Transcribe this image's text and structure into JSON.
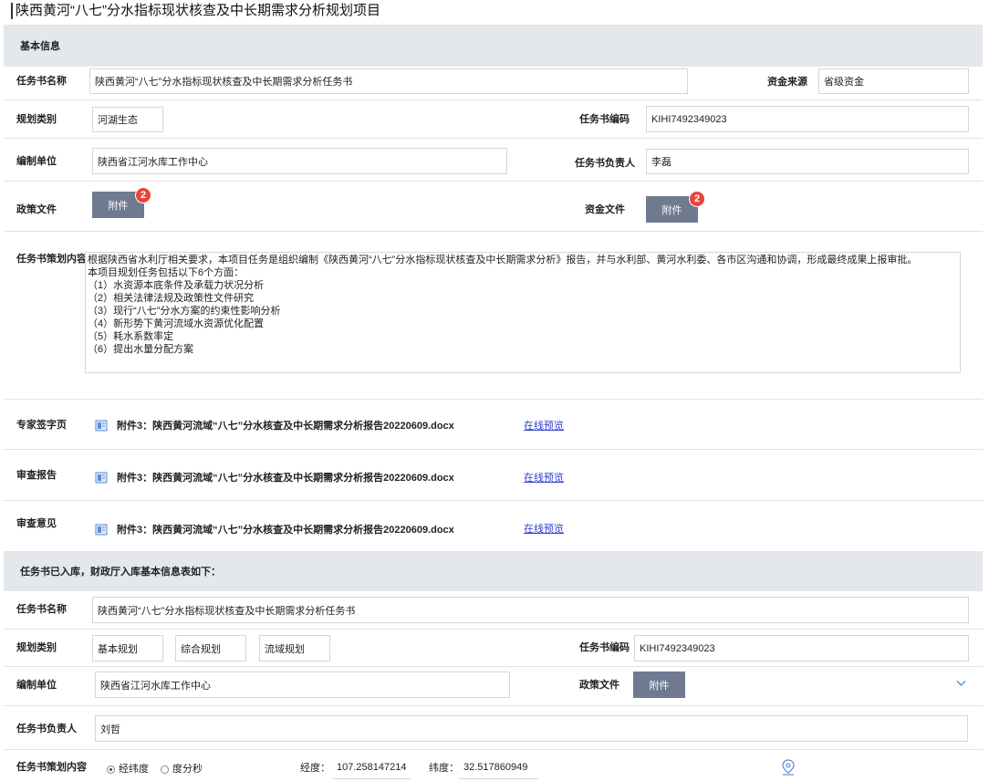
{
  "page_title": "陕西黄河“八七”分水指标现状核查及中长期需求分析规划项目",
  "basic": {
    "section_title": "基本信息",
    "task_name_label": "任务书名称",
    "task_name_value": "陕西黄河“八七”分水指标现状核查及中长期需求分析任务书",
    "fund_source_label": "资金来源",
    "fund_source_value": "省级资金",
    "plan_type_label": "规划类别",
    "plan_type_value": "河湖生态",
    "task_code_label": "任务书编码",
    "task_code_value": "KIHI7492349023",
    "org_label": "编制单位",
    "org_value": "陕西省江河水库工作中心",
    "owner_label": "任务书负责人",
    "owner_value": "李磊",
    "policy_file_label": "政策文件",
    "policy_attach_label": "附件",
    "policy_attach_count": "2",
    "fund_file_label": "资金文件",
    "fund_attach_label": "附件",
    "fund_attach_count": "2",
    "plan_content_label": "任务书策划内容",
    "plan_content_lines": [
      "根据陕西省水利厅相关要求，本项目任务是组织编制《陕西黄河“八七”分水指标现状核查及中长期需求分析》报告，并与水利部、黄河水利委、各市区沟通和协调，形成最终成果上报审批。",
      "本项目规划任务包括以下6个方面：",
      "（1）水资源本底条件及承载力状况分析",
      "（2）相关法律法规及政策性文件研究",
      "（3）现行“八七”分水方案的约束性影响分析",
      "（4）新形势下黄河流域水资源优化配置",
      "（5）耗水系数率定",
      "（6）提出水量分配方案"
    ]
  },
  "files": [
    {
      "label": "专家签字页",
      "file_name": "附件3：陕西黄河流域“八七”分水核查及中长期需求分析报告20220609.docx",
      "link": "在线预览",
      "icon": "document-icon"
    },
    {
      "label": "审查报告",
      "file_name": "附件3：陕西黄河流域“八七”分水核查及中长期需求分析报告20220609.docx",
      "link": "在线预览",
      "icon": "document-icon"
    },
    {
      "label": "审查意见",
      "file_name": "附件3：陕西黄河流域“八七”分水核查及中长期需求分析报告20220609.docx",
      "link": "在线预览",
      "icon": "document-icon"
    }
  ],
  "stored": {
    "section_title": "任务书已入库，财政厅入库基本信息表如下：",
    "task_name_label": "任务书名称",
    "task_name_value": "陕西黄河“八七”分水指标现状核查及中长期需求分析任务书",
    "plan_type_label": "规划类别",
    "plan_types": [
      "基本规划",
      "综合规划",
      "流域规划"
    ],
    "task_code_label": "任务书编码",
    "task_code_value": "KIHI7492349023",
    "org_label": "编制单位",
    "org_value": "陕西省江河水库工作中心",
    "policy_file_label": "政策文件",
    "policy_attach_label": "附件",
    "owner_label": "任务书负责人",
    "owner_value": "刘哲",
    "plan_content_label": "任务书策划内容",
    "radio_options": [
      "经纬度",
      "度分秒"
    ],
    "radio_selected": "经纬度",
    "lng_label": "经度：",
    "lng_value": "107.258147214",
    "lat_label": "纬度：",
    "lat_value": "32.517860949",
    "chevron_icon": "chevron-down-icon",
    "location_icon": "location-pin-icon"
  },
  "colors": {
    "section_bg": "#e4e8ec",
    "attach_button": "#6f7a90",
    "badge": "#e8453c",
    "link": "#2a3ecb",
    "icon_blue": "#5b8dd6"
  }
}
